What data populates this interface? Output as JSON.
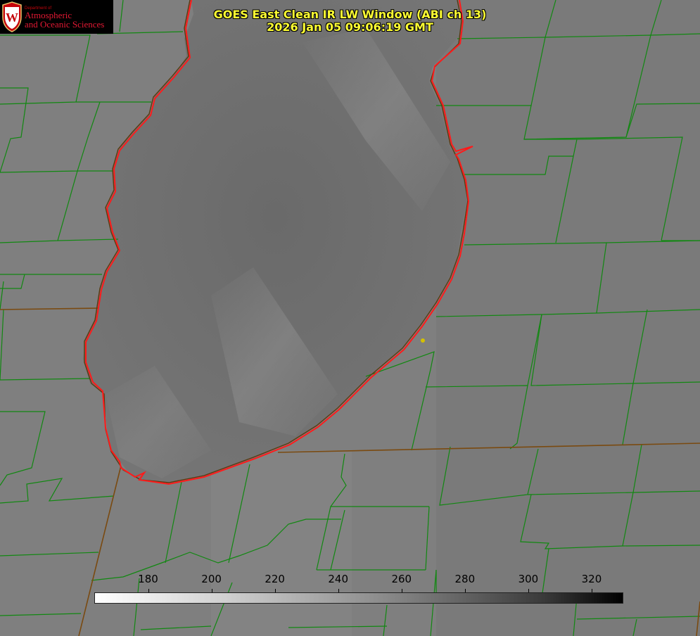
{
  "header": {
    "title_line1": "GOES East Clean IR LW Window (ABI ch 13)",
    "title_line2": "2026 Jan 05 09:06:19 GMT"
  },
  "logo": {
    "dept": "Department of",
    "line1": "Atmospheric",
    "line2": "and Oceanic Sciences",
    "crest_letter": "W"
  },
  "colorbar": {
    "ticks": [
      "180",
      "200",
      "220",
      "240",
      "260",
      "280",
      "300",
      "320"
    ],
    "min": 163,
    "max": 330,
    "scale": "grayscale-inverted"
  },
  "colors": {
    "county_lines": "#118811",
    "lake_outline": "#ff1a1a",
    "state_border": "#7a4a10",
    "title_text": "#ffff33",
    "marker": "#d4c000",
    "logo_red": "#e21833"
  },
  "icons": {
    "logo": "uw-crest-icon",
    "marker": "location-marker-icon"
  }
}
